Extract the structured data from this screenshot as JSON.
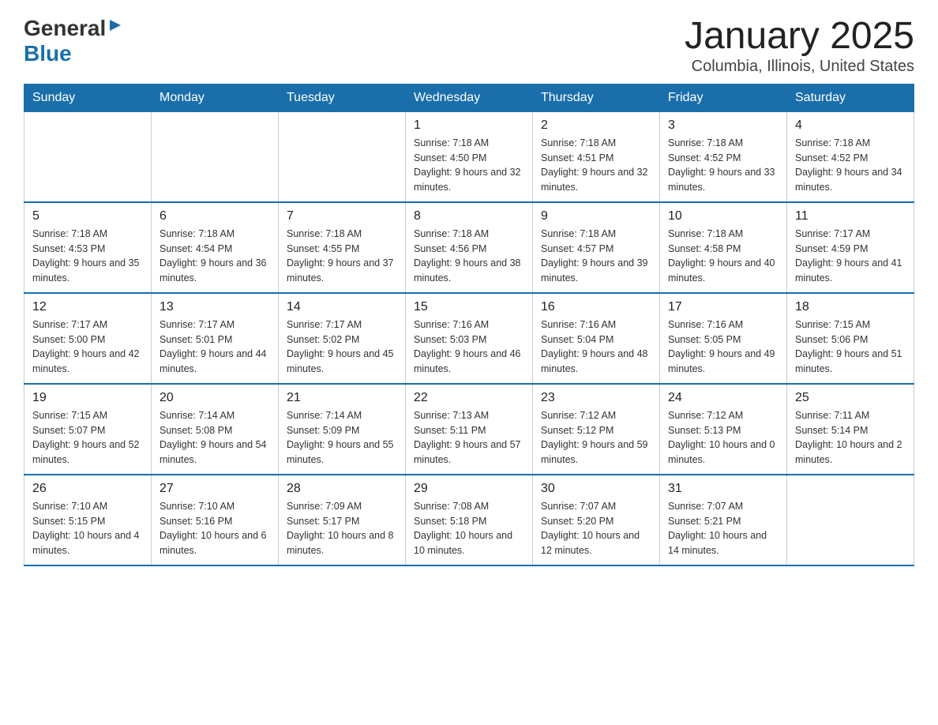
{
  "header": {
    "logo_general": "General",
    "logo_blue": "Blue",
    "title": "January 2025",
    "subtitle": "Columbia, Illinois, United States"
  },
  "days_of_week": [
    "Sunday",
    "Monday",
    "Tuesday",
    "Wednesday",
    "Thursday",
    "Friday",
    "Saturday"
  ],
  "weeks": [
    [
      {
        "day": "",
        "info": ""
      },
      {
        "day": "",
        "info": ""
      },
      {
        "day": "",
        "info": ""
      },
      {
        "day": "1",
        "info": "Sunrise: 7:18 AM\nSunset: 4:50 PM\nDaylight: 9 hours\nand 32 minutes."
      },
      {
        "day": "2",
        "info": "Sunrise: 7:18 AM\nSunset: 4:51 PM\nDaylight: 9 hours\nand 32 minutes."
      },
      {
        "day": "3",
        "info": "Sunrise: 7:18 AM\nSunset: 4:52 PM\nDaylight: 9 hours\nand 33 minutes."
      },
      {
        "day": "4",
        "info": "Sunrise: 7:18 AM\nSunset: 4:52 PM\nDaylight: 9 hours\nand 34 minutes."
      }
    ],
    [
      {
        "day": "5",
        "info": "Sunrise: 7:18 AM\nSunset: 4:53 PM\nDaylight: 9 hours\nand 35 minutes."
      },
      {
        "day": "6",
        "info": "Sunrise: 7:18 AM\nSunset: 4:54 PM\nDaylight: 9 hours\nand 36 minutes."
      },
      {
        "day": "7",
        "info": "Sunrise: 7:18 AM\nSunset: 4:55 PM\nDaylight: 9 hours\nand 37 minutes."
      },
      {
        "day": "8",
        "info": "Sunrise: 7:18 AM\nSunset: 4:56 PM\nDaylight: 9 hours\nand 38 minutes."
      },
      {
        "day": "9",
        "info": "Sunrise: 7:18 AM\nSunset: 4:57 PM\nDaylight: 9 hours\nand 39 minutes."
      },
      {
        "day": "10",
        "info": "Sunrise: 7:18 AM\nSunset: 4:58 PM\nDaylight: 9 hours\nand 40 minutes."
      },
      {
        "day": "11",
        "info": "Sunrise: 7:17 AM\nSunset: 4:59 PM\nDaylight: 9 hours\nand 41 minutes."
      }
    ],
    [
      {
        "day": "12",
        "info": "Sunrise: 7:17 AM\nSunset: 5:00 PM\nDaylight: 9 hours\nand 42 minutes."
      },
      {
        "day": "13",
        "info": "Sunrise: 7:17 AM\nSunset: 5:01 PM\nDaylight: 9 hours\nand 44 minutes."
      },
      {
        "day": "14",
        "info": "Sunrise: 7:17 AM\nSunset: 5:02 PM\nDaylight: 9 hours\nand 45 minutes."
      },
      {
        "day": "15",
        "info": "Sunrise: 7:16 AM\nSunset: 5:03 PM\nDaylight: 9 hours\nand 46 minutes."
      },
      {
        "day": "16",
        "info": "Sunrise: 7:16 AM\nSunset: 5:04 PM\nDaylight: 9 hours\nand 48 minutes."
      },
      {
        "day": "17",
        "info": "Sunrise: 7:16 AM\nSunset: 5:05 PM\nDaylight: 9 hours\nand 49 minutes."
      },
      {
        "day": "18",
        "info": "Sunrise: 7:15 AM\nSunset: 5:06 PM\nDaylight: 9 hours\nand 51 minutes."
      }
    ],
    [
      {
        "day": "19",
        "info": "Sunrise: 7:15 AM\nSunset: 5:07 PM\nDaylight: 9 hours\nand 52 minutes."
      },
      {
        "day": "20",
        "info": "Sunrise: 7:14 AM\nSunset: 5:08 PM\nDaylight: 9 hours\nand 54 minutes."
      },
      {
        "day": "21",
        "info": "Sunrise: 7:14 AM\nSunset: 5:09 PM\nDaylight: 9 hours\nand 55 minutes."
      },
      {
        "day": "22",
        "info": "Sunrise: 7:13 AM\nSunset: 5:11 PM\nDaylight: 9 hours\nand 57 minutes."
      },
      {
        "day": "23",
        "info": "Sunrise: 7:12 AM\nSunset: 5:12 PM\nDaylight: 9 hours\nand 59 minutes."
      },
      {
        "day": "24",
        "info": "Sunrise: 7:12 AM\nSunset: 5:13 PM\nDaylight: 10 hours\nand 0 minutes."
      },
      {
        "day": "25",
        "info": "Sunrise: 7:11 AM\nSunset: 5:14 PM\nDaylight: 10 hours\nand 2 minutes."
      }
    ],
    [
      {
        "day": "26",
        "info": "Sunrise: 7:10 AM\nSunset: 5:15 PM\nDaylight: 10 hours\nand 4 minutes."
      },
      {
        "day": "27",
        "info": "Sunrise: 7:10 AM\nSunset: 5:16 PM\nDaylight: 10 hours\nand 6 minutes."
      },
      {
        "day": "28",
        "info": "Sunrise: 7:09 AM\nSunset: 5:17 PM\nDaylight: 10 hours\nand 8 minutes."
      },
      {
        "day": "29",
        "info": "Sunrise: 7:08 AM\nSunset: 5:18 PM\nDaylight: 10 hours\nand 10 minutes."
      },
      {
        "day": "30",
        "info": "Sunrise: 7:07 AM\nSunset: 5:20 PM\nDaylight: 10 hours\nand 12 minutes."
      },
      {
        "day": "31",
        "info": "Sunrise: 7:07 AM\nSunset: 5:21 PM\nDaylight: 10 hours\nand 14 minutes."
      },
      {
        "day": "",
        "info": ""
      }
    ]
  ]
}
